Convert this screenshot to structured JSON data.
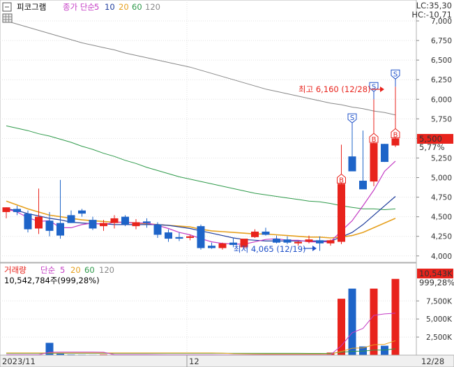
{
  "price_legend": {
    "program_label": "피코그램",
    "ma_label": "종가 단순",
    "periods": [
      "5",
      "10",
      "20",
      "60",
      "120"
    ]
  },
  "volume_legend": {
    "label": "거래량",
    "ma_label": "단순",
    "periods": [
      "5",
      "20",
      "60",
      "120"
    ],
    "current_text": "10,542,784주(999,28%)"
  },
  "corner_info": {
    "lc": "LC:35,30",
    "hc": "HC:-10,71"
  },
  "price_tags": {
    "last_price": "5,500",
    "change_pct": "5,77%"
  },
  "volume_tags": {
    "last_volume": "10,543K",
    "change_pct": "999,28%"
  },
  "annotations": {
    "high": "최고 6,160 (12/28)",
    "low": "최저 4,065 (12/19)"
  },
  "x_labels": {
    "start": "2023/11",
    "month": "12",
    "end": "12/28"
  },
  "colors": {
    "up": "#e8231c",
    "down": "#1e64c8",
    "ma5": "#c43cc4",
    "ma10": "#1e3c9c",
    "ma20": "#e6a01e",
    "ma60": "#2e9a4a",
    "ma120": "#888888",
    "signal": "#1e50c8"
  },
  "chart_data": {
    "type": "candlestick",
    "price_axis": {
      "ylim": [
        3900,
        7000
      ],
      "ticks": [
        "7,000",
        "6,750",
        "6,500",
        "6,250",
        "6,000",
        "5,750",
        "5,500",
        "5,250",
        "5,000",
        "4,750",
        "4,500",
        "4,250",
        "4,000"
      ]
    },
    "volume_axis": {
      "ylim": [
        0,
        11000
      ],
      "ticks": [
        "7,500K",
        "5,000K",
        "2,500K"
      ],
      "unit": "K"
    },
    "candles": [
      {
        "o": 4560,
        "h": 4620,
        "l": 4480,
        "c": 4620
      },
      {
        "o": 4600,
        "h": 4640,
        "l": 4520,
        "c": 4560
      },
      {
        "o": 4540,
        "h": 4580,
        "l": 4300,
        "c": 4340
      },
      {
        "o": 4350,
        "h": 4860,
        "l": 4280,
        "c": 4500
      },
      {
        "o": 4450,
        "h": 4560,
        "l": 4250,
        "c": 4320
      },
      {
        "o": 4420,
        "h": 4970,
        "l": 4220,
        "c": 4260
      },
      {
        "o": 4520,
        "h": 4580,
        "l": 4420,
        "c": 4420
      },
      {
        "o": 4580,
        "h": 4600,
        "l": 4500,
        "c": 4540
      },
      {
        "o": 4460,
        "h": 4500,
        "l": 4330,
        "c": 4350
      },
      {
        "o": 4380,
        "h": 4460,
        "l": 4320,
        "c": 4420
      },
      {
        "o": 4420,
        "h": 4520,
        "l": 4350,
        "c": 4480
      },
      {
        "o": 4500,
        "h": 4520,
        "l": 4380,
        "c": 4400
      },
      {
        "o": 4380,
        "h": 4470,
        "l": 4340,
        "c": 4430
      },
      {
        "o": 4440,
        "h": 4480,
        "l": 4360,
        "c": 4420
      },
      {
        "o": 4400,
        "h": 4430,
        "l": 4230,
        "c": 4270
      },
      {
        "o": 4300,
        "h": 4340,
        "l": 4180,
        "c": 4220
      },
      {
        "o": 4240,
        "h": 4300,
        "l": 4190,
        "c": 4220
      },
      {
        "o": 4230,
        "h": 4270,
        "l": 4200,
        "c": 4250
      },
      {
        "o": 4380,
        "h": 4400,
        "l": 4080,
        "c": 4100
      },
      {
        "o": 4130,
        "h": 4170,
        "l": 4090,
        "c": 4100
      },
      {
        "o": 4100,
        "h": 4170,
        "l": 4080,
        "c": 4160
      },
      {
        "o": 4170,
        "h": 4230,
        "l": 4110,
        "c": 4140
      },
      {
        "o": 4110,
        "h": 4200,
        "l": 4090,
        "c": 4220
      },
      {
        "o": 4240,
        "h": 4340,
        "l": 4230,
        "c": 4310
      },
      {
        "o": 4310,
        "h": 4360,
        "l": 4260,
        "c": 4270
      },
      {
        "o": 4220,
        "h": 4260,
        "l": 4160,
        "c": 4170
      },
      {
        "o": 4210,
        "h": 4250,
        "l": 4150,
        "c": 4170
      },
      {
        "o": 4160,
        "h": 4190,
        "l": 4130,
        "c": 4180
      },
      {
        "o": 4180,
        "h": 4260,
        "l": 4160,
        "c": 4210
      },
      {
        "o": 4200,
        "h": 4250,
        "l": 4065,
        "c": 4160
      },
      {
        "o": 4160,
        "h": 4210,
        "l": 4130,
        "c": 4200
      },
      {
        "o": 4180,
        "h": 5420,
        "l": 4150,
        "c": 4920
      },
      {
        "o": 5270,
        "h": 5600,
        "l": 5080,
        "c": 5080
      },
      {
        "o": 4960,
        "h": 5600,
        "l": 4860,
        "c": 4850
      },
      {
        "o": 4950,
        "h": 6000,
        "l": 4890,
        "c": 5440
      },
      {
        "o": 5430,
        "h": 5430,
        "l": 5200,
        "c": 5200
      },
      {
        "o": 5410,
        "h": 6160,
        "l": 5390,
        "c": 5500
      }
    ],
    "volume_k": [
      50,
      60,
      80,
      60,
      1700,
      200,
      90,
      70,
      60,
      100,
      60,
      50,
      60,
      60,
      50,
      40,
      40,
      40,
      50,
      40,
      40,
      40,
      50,
      60,
      50,
      40,
      40,
      40,
      40,
      50,
      350,
      7800,
      9200,
      1200,
      9200,
      1300,
      10543
    ],
    "ma5": [
      4600,
      4560,
      4490,
      4440,
      4450,
      4360,
      4360,
      4400,
      4420,
      4400,
      4430,
      4430,
      4420,
      4420,
      4390,
      4350,
      4300,
      4270,
      4220,
      4180,
      4160,
      4150,
      4150,
      4180,
      4210,
      4220,
      4200,
      4200,
      4180,
      4180,
      4180,
      4320,
      4450,
      4640,
      4840,
      5080,
      5210
    ],
    "ma10": [
      4600,
      4580,
      4540,
      4510,
      4480,
      4460,
      4430,
      4420,
      4410,
      4410,
      4400,
      4400,
      4400,
      4400,
      4400,
      4390,
      4370,
      4350,
      4320,
      4290,
      4260,
      4230,
      4210,
      4200,
      4190,
      4190,
      4190,
      4190,
      4190,
      4190,
      4190,
      4240,
      4300,
      4400,
      4520,
      4640,
      4760
    ],
    "ma20": [
      4700,
      4650,
      4600,
      4560,
      4520,
      4500,
      4480,
      4460,
      4450,
      4440,
      4430,
      4430,
      4420,
      4410,
      4400,
      4390,
      4380,
      4370,
      4340,
      4320,
      4310,
      4300,
      4290,
      4280,
      4280,
      4270,
      4260,
      4250,
      4240,
      4240,
      4230,
      4240,
      4260,
      4300,
      4360,
      4420,
      4480
    ],
    "ma60": [
      5660,
      5630,
      5600,
      5560,
      5530,
      5490,
      5450,
      5400,
      5360,
      5310,
      5270,
      5220,
      5180,
      5130,
      5090,
      5050,
      5010,
      4980,
      4950,
      4920,
      4890,
      4860,
      4830,
      4800,
      4780,
      4760,
      4740,
      4720,
      4700,
      4690,
      4670,
      4640,
      4620,
      4600,
      4600,
      4590,
      4600
    ],
    "ma120": [
      7000,
      6960,
      6920,
      6880,
      6840,
      6800,
      6760,
      6720,
      6690,
      6660,
      6630,
      6590,
      6560,
      6530,
      6500,
      6470,
      6440,
      6410,
      6370,
      6330,
      6290,
      6250,
      6210,
      6170,
      6130,
      6100,
      6070,
      6040,
      6010,
      5980,
      5950,
      5930,
      5900,
      5880,
      5850,
      5830,
      5800
    ],
    "vol_ma5": [
      60,
      60,
      60,
      60,
      400,
      420,
      420,
      420,
      420,
      400,
      80,
      70,
      70,
      70,
      60,
      50,
      50,
      50,
      50,
      50,
      40,
      40,
      40,
      50,
      50,
      50,
      50,
      50,
      50,
      50,
      50,
      1300,
      3100,
      3700,
      5500,
      5700,
      5800
    ],
    "vol_ma20": [
      300,
      300,
      300,
      300,
      300,
      300,
      300,
      300,
      300,
      300,
      300,
      300,
      300,
      300,
      300,
      300,
      300,
      300,
      300,
      300,
      280,
      200,
      180,
      160,
      150,
      150,
      150,
      150,
      150,
      150,
      160,
      500,
      960,
      1000,
      1440,
      1500,
      2000
    ],
    "vol_ma60": [
      250,
      250,
      250,
      250,
      250,
      250,
      250,
      250,
      250,
      250,
      250,
      250,
      250,
      250,
      250,
      250,
      250,
      250,
      250,
      250,
      250,
      250,
      250,
      250,
      250,
      250,
      250,
      250,
      240,
      240,
      250,
      400,
      520,
      550,
      700,
      700,
      900
    ],
    "signals": [
      {
        "index": 31,
        "type": "B"
      },
      {
        "index": 32,
        "type": "S"
      },
      {
        "index": 34,
        "type": "B"
      },
      {
        "index": 34,
        "type": "S"
      },
      {
        "index": 36,
        "type": "B"
      },
      {
        "index": 36,
        "type": "S"
      }
    ]
  }
}
